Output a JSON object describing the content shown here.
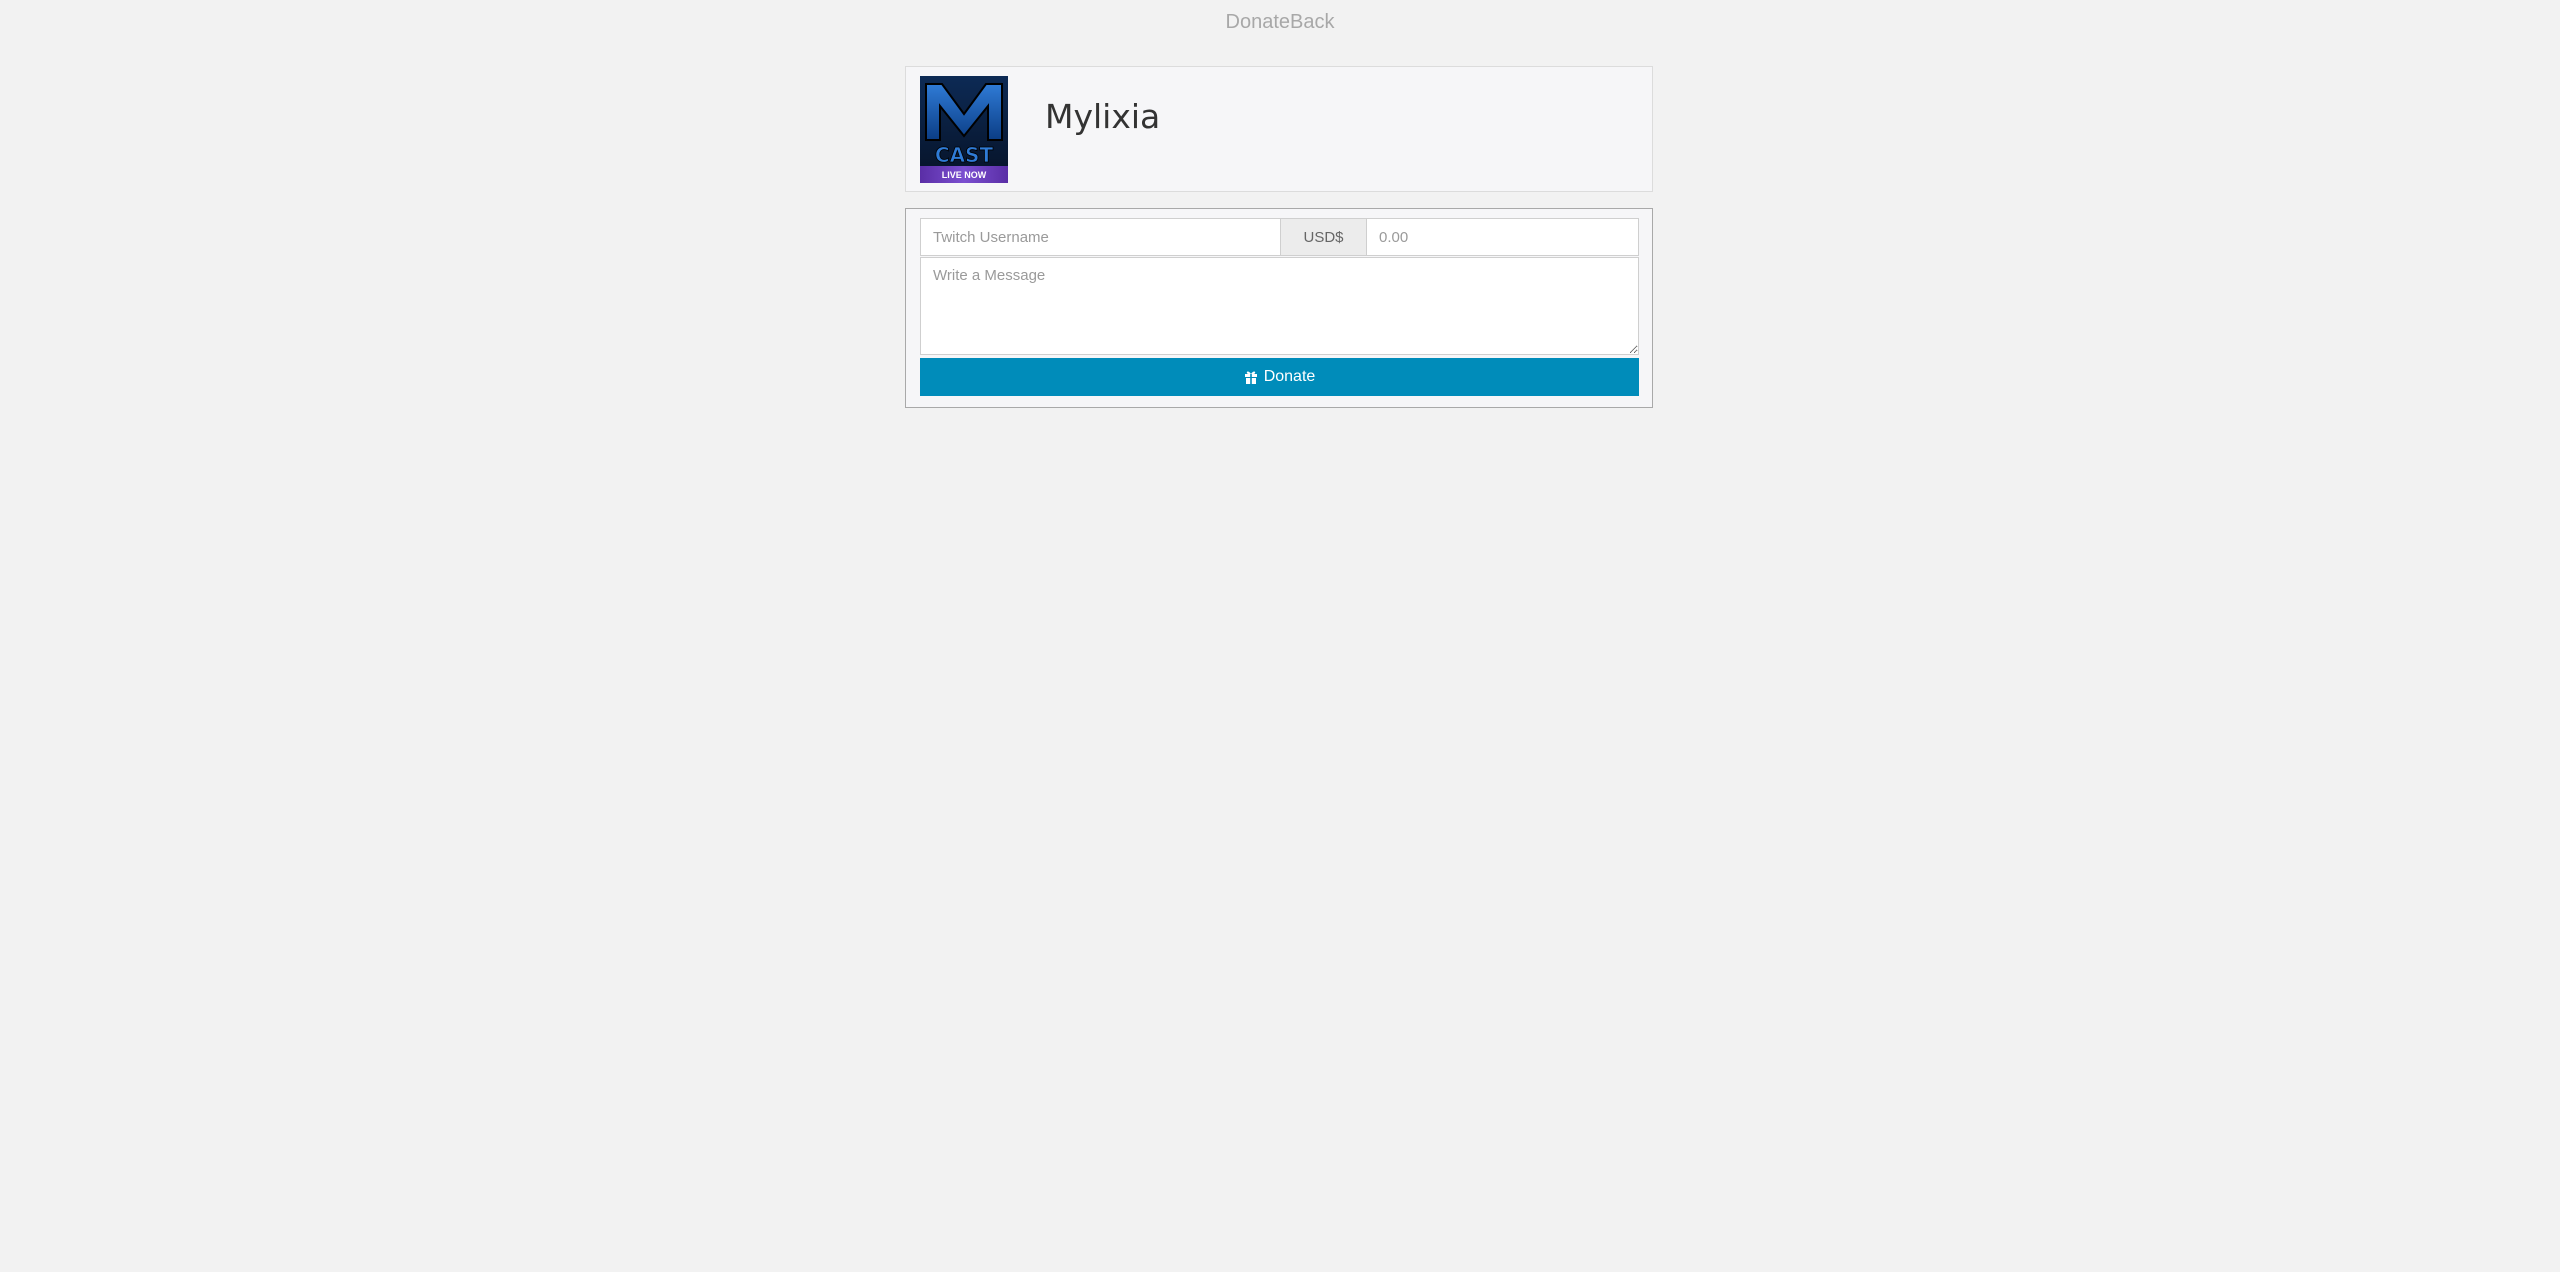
{
  "site": {
    "title": "DonateBack"
  },
  "profile": {
    "name": "Mylixia",
    "avatar": {
      "logo_letter": "M",
      "logo_word": "CAST",
      "badge": "LIVE NOW"
    }
  },
  "donation_form": {
    "username_placeholder": "Twitch Username",
    "currency_label": "USD$",
    "amount_placeholder": "0.00",
    "message_placeholder": "Write a Message",
    "donate_label": "Donate",
    "donate_icon": "gift-icon"
  },
  "colors": {
    "background": "#f2f2f2",
    "button": "#008cba",
    "badge": "#6a3fb5"
  }
}
